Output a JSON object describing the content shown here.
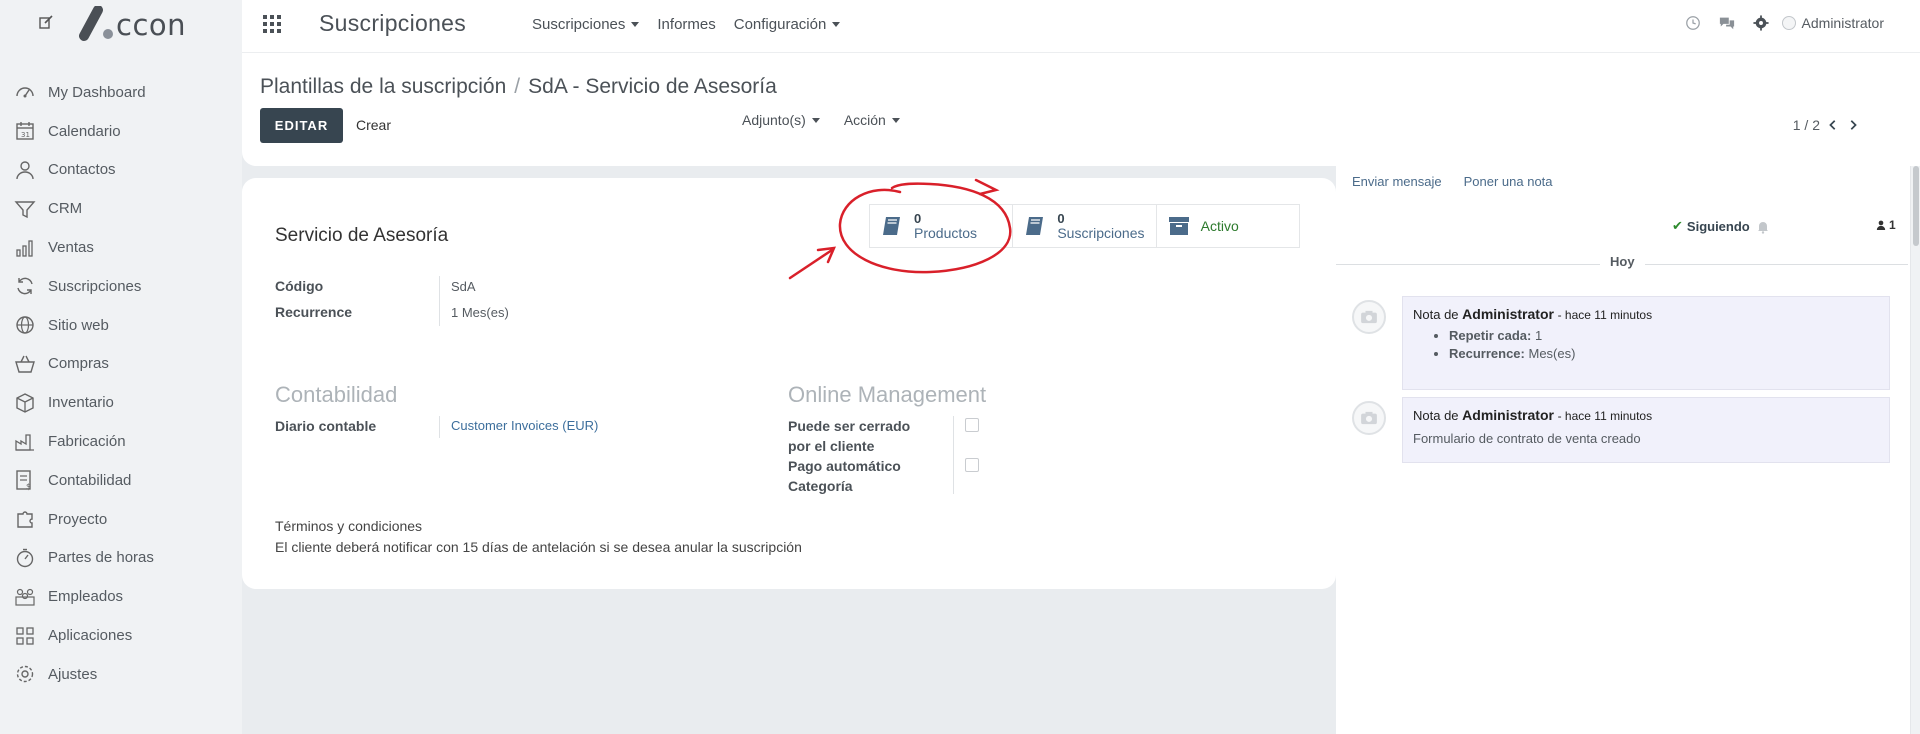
{
  "brand": {
    "logo_text": "ccon"
  },
  "sidebar": {
    "items": [
      {
        "label": "My Dashboard",
        "icon": "dashboard-icon"
      },
      {
        "label": "Calendario",
        "icon": "calendar-icon"
      },
      {
        "label": "Contactos",
        "icon": "user-icon"
      },
      {
        "label": "CRM",
        "icon": "funnel-icon"
      },
      {
        "label": "Ventas",
        "icon": "bar-chart-icon"
      },
      {
        "label": "Suscripciones",
        "icon": "refresh-icon"
      },
      {
        "label": "Sitio web",
        "icon": "globe-icon"
      },
      {
        "label": "Compras",
        "icon": "basket-icon"
      },
      {
        "label": "Inventario",
        "icon": "box-icon"
      },
      {
        "label": "Fabricación",
        "icon": "factory-icon"
      },
      {
        "label": "Contabilidad",
        "icon": "invoice-icon"
      },
      {
        "label": "Proyecto",
        "icon": "puzzle-icon"
      },
      {
        "label": "Partes de horas",
        "icon": "stopwatch-icon"
      },
      {
        "label": "Empleados",
        "icon": "team-icon"
      },
      {
        "label": "Aplicaciones",
        "icon": "apps-grid-icon"
      },
      {
        "label": "Ajustes",
        "icon": "gear-icon"
      }
    ]
  },
  "topbar": {
    "app_title": "Suscripciones",
    "nav": [
      "Suscripciones",
      "Informes",
      "Configuración"
    ],
    "user": "Administrator"
  },
  "control_panel": {
    "breadcrumb_parent": "Plantillas de la suscripción",
    "breadcrumb_sep": "/",
    "breadcrumb_current": "SdA - Servicio de Asesoría",
    "edit_label": "EDITAR",
    "create_label": "Crear",
    "attachments_label": "Adjunto(s)",
    "action_label": "Acción",
    "pager": "1 / 2"
  },
  "form": {
    "stat_buttons": {
      "products_count": "0",
      "products_label": "Productos",
      "subscriptions_count": "0",
      "subscriptions_label": "Suscripciones",
      "active_label": "Activo"
    },
    "name": "Servicio de Asesoría",
    "code_label": "Código",
    "code_value": "SdA",
    "recurrence_label": "Recurrence",
    "recurrence_value": "1 Mes(es)",
    "accounting_title": "Contabilidad",
    "journal_label": "Diario contable",
    "journal_value": "Customer Invoices (EUR)",
    "online_title": "Online Management",
    "closable_label_1": "Puede ser cerrado",
    "closable_label_2": "por el cliente",
    "auto_payment_label": "Pago automático",
    "category_label": "Categoría",
    "terms_title": "Términos y condiciones",
    "terms_text": "El cliente deberá notificar con 15 días de antelación si se desea anular la suscripción"
  },
  "chatter": {
    "send_message": "Enviar mensaje",
    "log_note": "Poner una nota",
    "following": "Siguiendo",
    "followers_count": "1",
    "today": "Hoy",
    "messages": [
      {
        "prefix": "Nota de",
        "author": "Administrator",
        "time": "- hace 11 minutos",
        "items": [
          {
            "label": "Repetir cada:",
            "value": "1"
          },
          {
            "label": "Recurrence:",
            "value": "Mes(es)"
          }
        ]
      },
      {
        "prefix": "Nota de",
        "author": "Administrator",
        "time": "- hace 11 minutos",
        "text": "Formulario de contrato de venta creado"
      }
    ]
  },
  "colors": {
    "primary_button": "#374550",
    "link": "#3c6e9c",
    "annotation": "#d9202a",
    "active_green": "#2d7a2d"
  }
}
